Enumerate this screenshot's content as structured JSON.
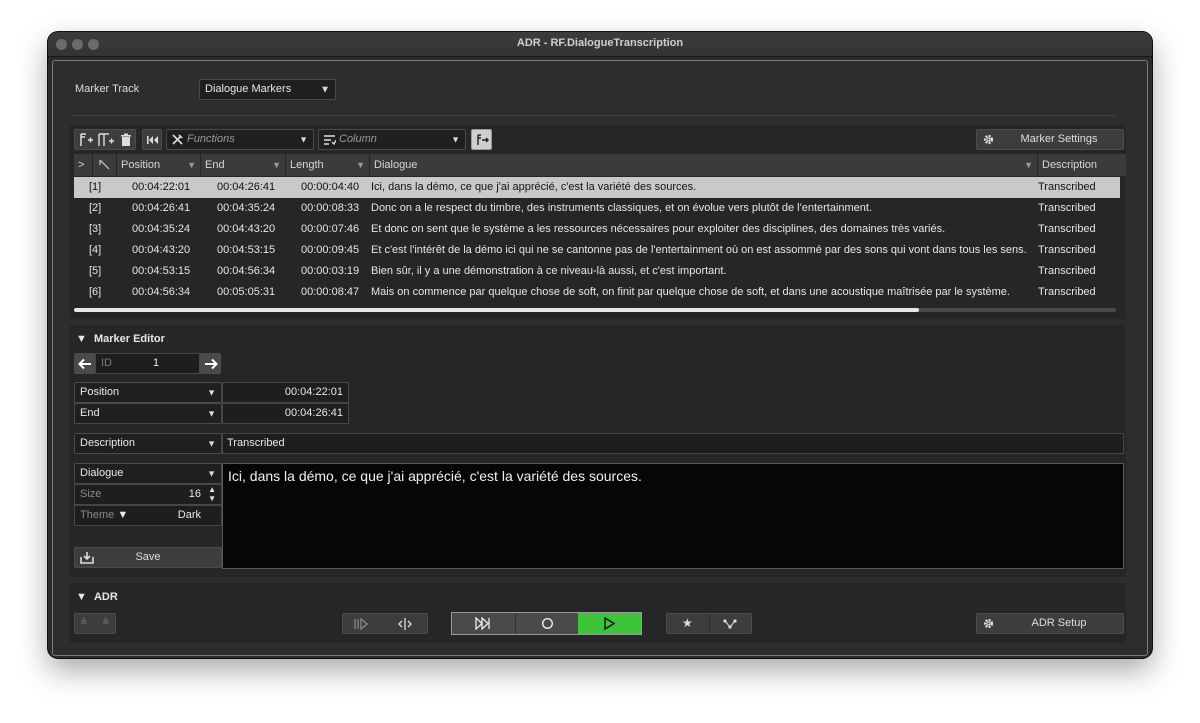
{
  "window": {
    "title": "ADR - RF.DialogueTranscription"
  },
  "marker_track": {
    "label": "Marker Track",
    "value": "Dialogue Markers"
  },
  "toolbar": {
    "functions_placeholder": "Functions",
    "column_placeholder": "Column",
    "marker_settings_label": "Marker Settings"
  },
  "table": {
    "headers": {
      "position": "Position",
      "end": "End",
      "length": "Length",
      "dialogue": "Dialogue",
      "description": "Description"
    },
    "rows": [
      {
        "id": "[1]",
        "position": "00:04:22:01",
        "end": "00:04:26:41",
        "length": "00:00:04:40",
        "dialogue": "Ici, dans la démo, ce que j'ai apprécié, c'est la variété des sources.",
        "description": "Transcribed"
      },
      {
        "id": "[2]",
        "position": "00:04:26:41",
        "end": "00:04:35:24",
        "length": "00:00:08:33",
        "dialogue": "Donc on a le respect du timbre, des instruments classiques, et on évolue vers plutôt de l'entertainment.",
        "description": "Transcribed"
      },
      {
        "id": "[3]",
        "position": "00:04:35:24",
        "end": "00:04:43:20",
        "length": "00:00:07:46",
        "dialogue": "Et donc on sent que le système a les ressources nécessaires pour exploiter des disciplines, des domaines très variés.",
        "description": "Transcribed"
      },
      {
        "id": "[4]",
        "position": "00:04:43:20",
        "end": "00:04:53:15",
        "length": "00:00:09:45",
        "dialogue": "Et c'est l'intérêt de la démo ici qui ne se cantonne pas de l'entertainment où on est assommé par des sons qui vont dans tous les sens.",
        "description": "Transcribed"
      },
      {
        "id": "[5]",
        "position": "00:04:53:15",
        "end": "00:04:56:34",
        "length": "00:00:03:19",
        "dialogue": "Bien sûr, il y a une démonstration à ce niveau-là aussi, et c'est important.",
        "description": "Transcribed"
      },
      {
        "id": "[6]",
        "position": "00:04:56:34",
        "end": "00:05:05:31",
        "length": "00:00:08:47",
        "dialogue": "Mais on commence par quelque chose de soft, on finit par quelque chose de soft, et dans une acoustique maîtrisée par le système.",
        "description": "Transcribed"
      }
    ]
  },
  "marker_editor": {
    "title": "Marker Editor",
    "id_label": "ID",
    "id_value": "1",
    "position_label": "Position",
    "position_value": "00:04:22:01",
    "end_label": "End",
    "end_value": "00:04:26:41",
    "description_label": "Description",
    "description_value": "Transcribed",
    "dialogue_label": "Dialogue",
    "size_label": "Size",
    "size_value": "16",
    "theme_label": "Theme",
    "theme_value": "Dark",
    "save_label": "Save",
    "dialogue_text": "Ici, dans la démo, ce que j'ai apprécié, c'est la variété des sources."
  },
  "adr": {
    "title": "ADR",
    "setup_label": "ADR Setup",
    "record_active_color": "#3ec43a"
  }
}
